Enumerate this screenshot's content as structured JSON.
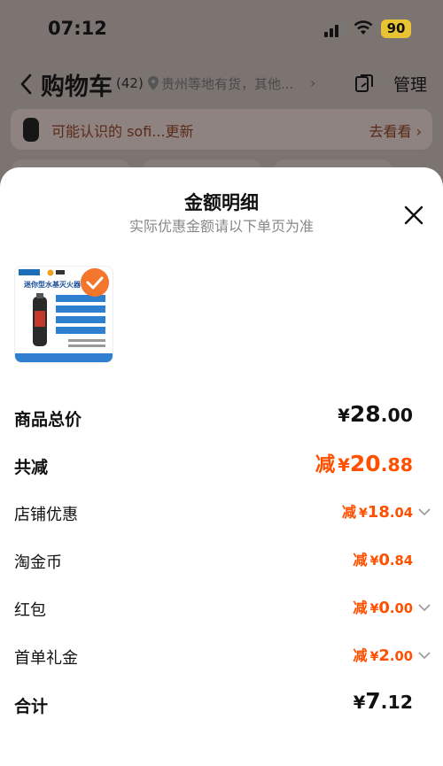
{
  "status_bar": {
    "time": "07:12",
    "battery": "90"
  },
  "nav": {
    "back_icon": "chevron-left-icon",
    "title": "购物车",
    "count": "(42)",
    "location": "贵州等地有货，其他...",
    "manage": "管理",
    "share_icon": "share-list-icon"
  },
  "friend_banner": {
    "text": "可能认识的 sofi...更新",
    "action": "去看看 ›"
  },
  "sheet": {
    "title": "金额明细",
    "subtitle": "实际优惠金额请以下单页为准",
    "close_icon": "close-icon",
    "product": {
      "image_text": "迷你型水基灭火器",
      "selected": true
    }
  },
  "breakdown": [
    {
      "label": "商品总价",
      "prefix": "",
      "currency": "¥",
      "int": "28",
      "dec": ".00",
      "bold": true,
      "highlight": false,
      "expandable": false
    },
    {
      "label": "共减",
      "prefix": "减",
      "currency": "¥",
      "int": "20",
      "dec": ".88",
      "bold": true,
      "highlight": true,
      "expandable": false
    },
    {
      "label": "店铺优惠",
      "prefix": "减",
      "currency": "¥",
      "int": "18",
      "dec": ".04",
      "bold": false,
      "highlight": true,
      "expandable": true
    },
    {
      "label": "淘金币",
      "prefix": "减",
      "currency": "¥",
      "int": "0",
      "dec": ".84",
      "bold": false,
      "highlight": true,
      "expandable": false
    },
    {
      "label": "红包",
      "prefix": "减",
      "currency": "¥",
      "int": "0",
      "dec": ".00",
      "bold": false,
      "highlight": true,
      "expandable": true
    },
    {
      "label": "首单礼金",
      "prefix": "减",
      "currency": "¥",
      "int": "2",
      "dec": ".00",
      "bold": false,
      "highlight": true,
      "expandable": true
    },
    {
      "label": "合计",
      "prefix": "",
      "currency": "¥",
      "int": "7",
      "dec": ".12",
      "bold": true,
      "highlight": false,
      "expandable": false
    }
  ],
  "colors": {
    "accent": "#ff5000",
    "sheet_bg": "#ffffff",
    "overlay": "#7b7470"
  }
}
